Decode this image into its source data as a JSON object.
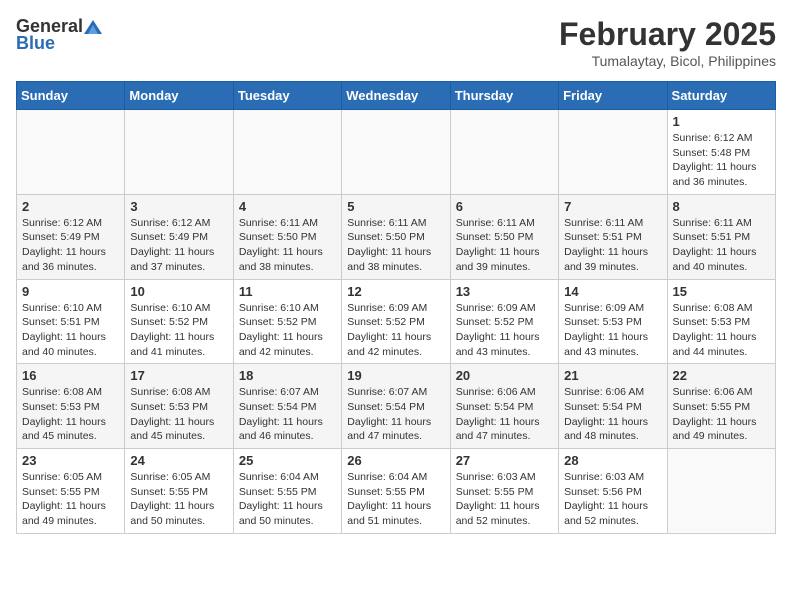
{
  "logo": {
    "general": "General",
    "blue": "Blue"
  },
  "header": {
    "month": "February 2025",
    "location": "Tumalaytay, Bicol, Philippines"
  },
  "days_of_week": [
    "Sunday",
    "Monday",
    "Tuesday",
    "Wednesday",
    "Thursday",
    "Friday",
    "Saturday"
  ],
  "weeks": [
    [
      {
        "day": "",
        "info": ""
      },
      {
        "day": "",
        "info": ""
      },
      {
        "day": "",
        "info": ""
      },
      {
        "day": "",
        "info": ""
      },
      {
        "day": "",
        "info": ""
      },
      {
        "day": "",
        "info": ""
      },
      {
        "day": "1",
        "info": "Sunrise: 6:12 AM\nSunset: 5:48 PM\nDaylight: 11 hours\nand 36 minutes."
      }
    ],
    [
      {
        "day": "2",
        "info": "Sunrise: 6:12 AM\nSunset: 5:49 PM\nDaylight: 11 hours\nand 36 minutes."
      },
      {
        "day": "3",
        "info": "Sunrise: 6:12 AM\nSunset: 5:49 PM\nDaylight: 11 hours\nand 37 minutes."
      },
      {
        "day": "4",
        "info": "Sunrise: 6:11 AM\nSunset: 5:50 PM\nDaylight: 11 hours\nand 38 minutes."
      },
      {
        "day": "5",
        "info": "Sunrise: 6:11 AM\nSunset: 5:50 PM\nDaylight: 11 hours\nand 38 minutes."
      },
      {
        "day": "6",
        "info": "Sunrise: 6:11 AM\nSunset: 5:50 PM\nDaylight: 11 hours\nand 39 minutes."
      },
      {
        "day": "7",
        "info": "Sunrise: 6:11 AM\nSunset: 5:51 PM\nDaylight: 11 hours\nand 39 minutes."
      },
      {
        "day": "8",
        "info": "Sunrise: 6:11 AM\nSunset: 5:51 PM\nDaylight: 11 hours\nand 40 minutes."
      }
    ],
    [
      {
        "day": "9",
        "info": "Sunrise: 6:10 AM\nSunset: 5:51 PM\nDaylight: 11 hours\nand 40 minutes."
      },
      {
        "day": "10",
        "info": "Sunrise: 6:10 AM\nSunset: 5:52 PM\nDaylight: 11 hours\nand 41 minutes."
      },
      {
        "day": "11",
        "info": "Sunrise: 6:10 AM\nSunset: 5:52 PM\nDaylight: 11 hours\nand 42 minutes."
      },
      {
        "day": "12",
        "info": "Sunrise: 6:09 AM\nSunset: 5:52 PM\nDaylight: 11 hours\nand 42 minutes."
      },
      {
        "day": "13",
        "info": "Sunrise: 6:09 AM\nSunset: 5:52 PM\nDaylight: 11 hours\nand 43 minutes."
      },
      {
        "day": "14",
        "info": "Sunrise: 6:09 AM\nSunset: 5:53 PM\nDaylight: 11 hours\nand 43 minutes."
      },
      {
        "day": "15",
        "info": "Sunrise: 6:08 AM\nSunset: 5:53 PM\nDaylight: 11 hours\nand 44 minutes."
      }
    ],
    [
      {
        "day": "16",
        "info": "Sunrise: 6:08 AM\nSunset: 5:53 PM\nDaylight: 11 hours\nand 45 minutes."
      },
      {
        "day": "17",
        "info": "Sunrise: 6:08 AM\nSunset: 5:53 PM\nDaylight: 11 hours\nand 45 minutes."
      },
      {
        "day": "18",
        "info": "Sunrise: 6:07 AM\nSunset: 5:54 PM\nDaylight: 11 hours\nand 46 minutes."
      },
      {
        "day": "19",
        "info": "Sunrise: 6:07 AM\nSunset: 5:54 PM\nDaylight: 11 hours\nand 47 minutes."
      },
      {
        "day": "20",
        "info": "Sunrise: 6:06 AM\nSunset: 5:54 PM\nDaylight: 11 hours\nand 47 minutes."
      },
      {
        "day": "21",
        "info": "Sunrise: 6:06 AM\nSunset: 5:54 PM\nDaylight: 11 hours\nand 48 minutes."
      },
      {
        "day": "22",
        "info": "Sunrise: 6:06 AM\nSunset: 5:55 PM\nDaylight: 11 hours\nand 49 minutes."
      }
    ],
    [
      {
        "day": "23",
        "info": "Sunrise: 6:05 AM\nSunset: 5:55 PM\nDaylight: 11 hours\nand 49 minutes."
      },
      {
        "day": "24",
        "info": "Sunrise: 6:05 AM\nSunset: 5:55 PM\nDaylight: 11 hours\nand 50 minutes."
      },
      {
        "day": "25",
        "info": "Sunrise: 6:04 AM\nSunset: 5:55 PM\nDaylight: 11 hours\nand 50 minutes."
      },
      {
        "day": "26",
        "info": "Sunrise: 6:04 AM\nSunset: 5:55 PM\nDaylight: 11 hours\nand 51 minutes."
      },
      {
        "day": "27",
        "info": "Sunrise: 6:03 AM\nSunset: 5:55 PM\nDaylight: 11 hours\nand 52 minutes."
      },
      {
        "day": "28",
        "info": "Sunrise: 6:03 AM\nSunset: 5:56 PM\nDaylight: 11 hours\nand 52 minutes."
      },
      {
        "day": "",
        "info": ""
      }
    ]
  ]
}
